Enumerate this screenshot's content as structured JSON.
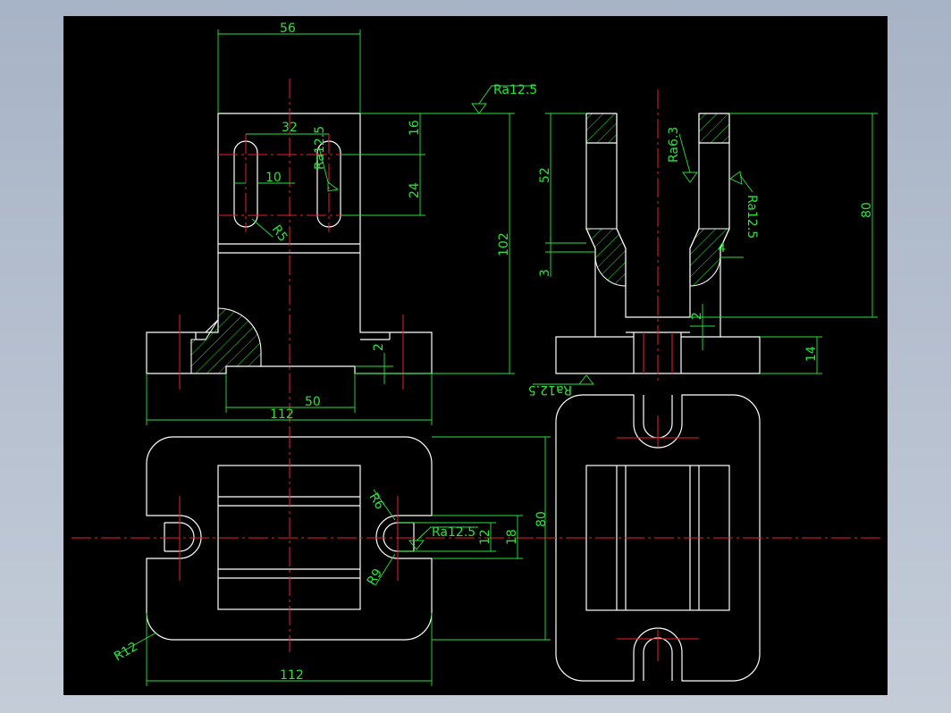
{
  "drawing": {
    "background": "#000000",
    "colors": {
      "outline": "#ffffff",
      "centerline": "#e8212b",
      "dimension": "#27e33a"
    },
    "dimensions": {
      "d56": "56",
      "d32": "32",
      "d10": "10",
      "d16": "16",
      "d24": "24",
      "d102": "102",
      "d2a": "2",
      "d50": "50",
      "d112a": "112",
      "d52": "52",
      "d3": "3",
      "d80a": "80",
      "d2b": "2",
      "d4": "4",
      "d14": "14",
      "d80b": "80",
      "d12": "12",
      "d18": "18",
      "d112b": "112"
    },
    "radii": {
      "r5": "R5",
      "r6": "R6",
      "r9": "R9",
      "r12": "R12"
    },
    "roughness": {
      "ra1": "Ra12.5",
      "ra2": "Ra12.5",
      "ra3": "Ra6.3",
      "ra4": "Ra12.5",
      "ra5": "Ra12.5",
      "ra6": "Ra12.5"
    }
  }
}
